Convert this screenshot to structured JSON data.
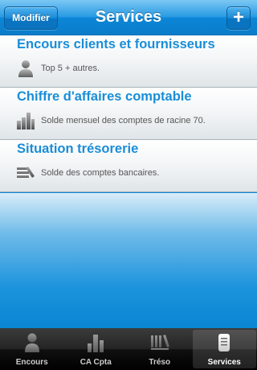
{
  "navbar": {
    "title": "Services",
    "modifier_label": "Modifier",
    "add_label": "+"
  },
  "cells": [
    {
      "title": "Encours clients et fournisseurs",
      "subtitle": "Top 5 + autres.",
      "icon": "person-icon"
    },
    {
      "title": "Chiffre d'affaires comptable",
      "subtitle": "Solde mensuel des comptes de racine 70.",
      "icon": "bar-chart-icon"
    },
    {
      "title": "Situation trésorerie",
      "subtitle": "Solde des comptes bancaires.",
      "icon": "books-icon"
    }
  ],
  "tabs": [
    {
      "label": "Encours",
      "icon": "person-icon",
      "active": false
    },
    {
      "label": "CA Cpta",
      "icon": "bar-chart-icon",
      "active": false
    },
    {
      "label": "Tréso",
      "icon": "books-icon",
      "active": false
    },
    {
      "label": "Services",
      "icon": "database-icon",
      "active": true
    }
  ],
  "colors": {
    "accent": "#1a8ed8",
    "navbar": "#0c86d7",
    "tabbar": "#000000"
  }
}
